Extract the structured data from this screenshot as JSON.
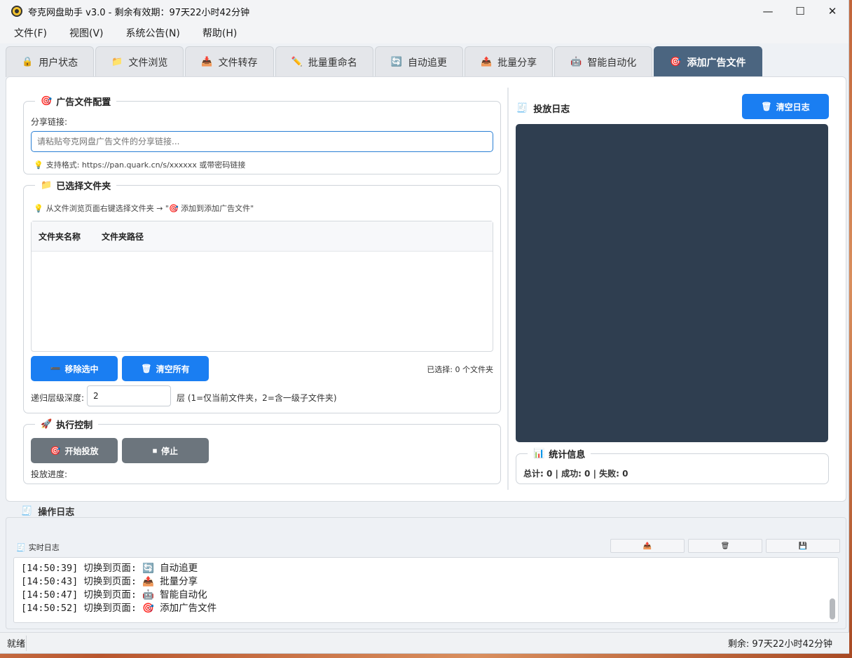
{
  "window": {
    "title": "夸克网盘助手 v3.0 - 剩余有效期：97天22小时42分钟",
    "minimize": "—",
    "maximize": "☐",
    "close": "✕"
  },
  "menu": [
    "文件(F)",
    "视图(V)",
    "系统公告(N)",
    "帮助(H)"
  ],
  "tabs": [
    {
      "label": "用户状态",
      "icon": "🔒"
    },
    {
      "label": "文件浏览",
      "icon": "📁"
    },
    {
      "label": "文件转存",
      "icon": "📥"
    },
    {
      "label": "批量重命名",
      "icon": "✏️"
    },
    {
      "label": "自动追更",
      "icon": "🔄"
    },
    {
      "label": "批量分享",
      "icon": "📤"
    },
    {
      "label": "智能自动化",
      "icon": "🤖"
    },
    {
      "label": "添加广告文件",
      "icon": "🎯"
    }
  ],
  "ad_config": {
    "title": "广告文件配置",
    "share_label": "分享链接:",
    "share_placeholder": "请粘贴夸克网盘广告文件的分享链接...",
    "hint": "支持格式: https://pan.quark.cn/s/xxxxxx 或带密码链接"
  },
  "folders": {
    "title": "已选择文件夹",
    "hint": "从文件浏览页面右键选择文件夹 → \"🎯 添加到添加广告文件\"",
    "col_name": "文件夹名称",
    "col_path": "文件夹路径",
    "remove_btn": "移除选中",
    "clear_btn": "清空所有",
    "selected_count": "已选择: 0 个文件夹",
    "depth_label": "递归层级深度:",
    "depth_value": "2",
    "depth_hint": "层 (1=仅当前文件夹，2=含一级子文件夹)"
  },
  "exec": {
    "title": "执行控制",
    "start_btn": "开始投放",
    "stop_btn": "停止",
    "progress_label": "投放进度:"
  },
  "deploy_log": {
    "title": "投放日志",
    "clear_btn": "清空日志"
  },
  "stats": {
    "title": "统计信息",
    "text": "总计: 0 | 成功: 0 | 失败: 0"
  },
  "oplog": {
    "title": "操作日志",
    "realtime_label": "实时日志",
    "lines": [
      {
        "time": "[14:50:39]",
        "text": "切换到页面:",
        "icon": "🔄",
        "page": "自动追更"
      },
      {
        "time": "[14:50:43]",
        "text": "切换到页面:",
        "icon": "📤",
        "page": "批量分享"
      },
      {
        "time": "[14:50:47]",
        "text": "切换到页面:",
        "icon": "🤖",
        "page": "智能自动化"
      },
      {
        "time": "[14:50:52]",
        "text": "切换到页面:",
        "icon": "🎯",
        "page": "添加广告文件"
      }
    ]
  },
  "status": {
    "left": "就绪",
    "right": "剩余: 97天22小时42分钟"
  },
  "icons": {
    "ad_config": "target-icon",
    "folders": "folder-icon",
    "exec": "rocket-icon",
    "deploy_log": "receipt-icon",
    "stats": "bar-chart-icon",
    "clear": "trash-icon",
    "export": "export-icon",
    "save": "save-icon"
  }
}
